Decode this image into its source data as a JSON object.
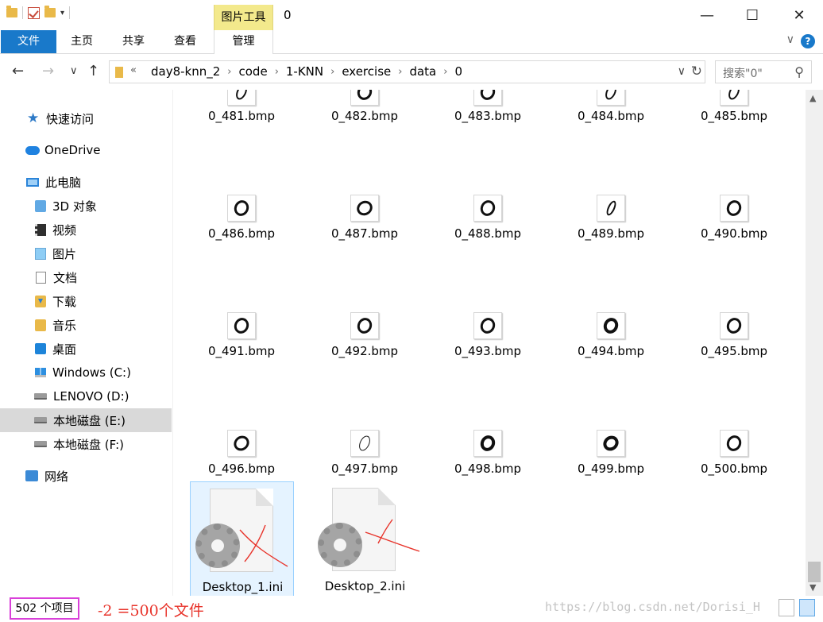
{
  "window": {
    "title": "0",
    "contextual_tab": "图片工具",
    "minimize": "—",
    "maximize": "☐",
    "close": "✕"
  },
  "ribbon": {
    "tabs": [
      {
        "label": "文件"
      },
      {
        "label": "主页"
      },
      {
        "label": "共享"
      },
      {
        "label": "查看"
      },
      {
        "label": "管理"
      }
    ],
    "expand": "∨",
    "help": "?"
  },
  "address": {
    "overflow": "«",
    "crumbs": [
      "day8-knn_2",
      "code",
      "1-KNN",
      "exercise",
      "data",
      "0"
    ],
    "separator": "›",
    "search_placeholder": "搜索\"0\""
  },
  "sidebar": {
    "items": [
      {
        "label": "快速访问",
        "icon": "star-icon"
      },
      {
        "label": "OneDrive",
        "icon": "cloud-icon"
      },
      {
        "label": "此电脑",
        "icon": "computer-icon"
      },
      {
        "label": "3D 对象",
        "icon": "3d-objects-icon"
      },
      {
        "label": "视频",
        "icon": "video-icon"
      },
      {
        "label": "图片",
        "icon": "pictures-icon"
      },
      {
        "label": "文档",
        "icon": "documents-icon"
      },
      {
        "label": "下载",
        "icon": "download-icon"
      },
      {
        "label": "音乐",
        "icon": "music-icon"
      },
      {
        "label": "桌面",
        "icon": "desktop-icon"
      },
      {
        "label": "Windows (C:)",
        "icon": "windows-drive-icon"
      },
      {
        "label": "LENOVO (D:)",
        "icon": "drive-icon"
      },
      {
        "label": "本地磁盘 (E:)",
        "icon": "drive-icon"
      },
      {
        "label": "本地磁盘 (F:)",
        "icon": "drive-icon"
      },
      {
        "label": "网络",
        "icon": "network-icon"
      }
    ],
    "selected": "本地磁盘 (E:)"
  },
  "files": {
    "rows": [
      [
        "0_481.bmp",
        "0_482.bmp",
        "0_483.bmp",
        "0_484.bmp",
        "0_485.bmp"
      ],
      [
        "0_486.bmp",
        "0_487.bmp",
        "0_488.bmp",
        "0_489.bmp",
        "0_490.bmp"
      ],
      [
        "0_491.bmp",
        "0_492.bmp",
        "0_493.bmp",
        "0_494.bmp",
        "0_495.bmp"
      ],
      [
        "0_496.bmp",
        "0_497.bmp",
        "0_498.bmp",
        "0_499.bmp",
        "0_500.bmp"
      ]
    ],
    "ini": [
      "Desktop_1.ini",
      "Desktop_2.ini"
    ]
  },
  "status": {
    "count": "502 个项目",
    "annotation": "-2 =500个文件",
    "watermark": "https://blog.csdn.net/Dorisi_H"
  },
  "colors": {
    "accent": "#1979ca",
    "contextual": "#f3e98c",
    "highlight_box": "#d940d9",
    "annotation": "#e8332a",
    "selected_bg": "#d9d9d9"
  }
}
